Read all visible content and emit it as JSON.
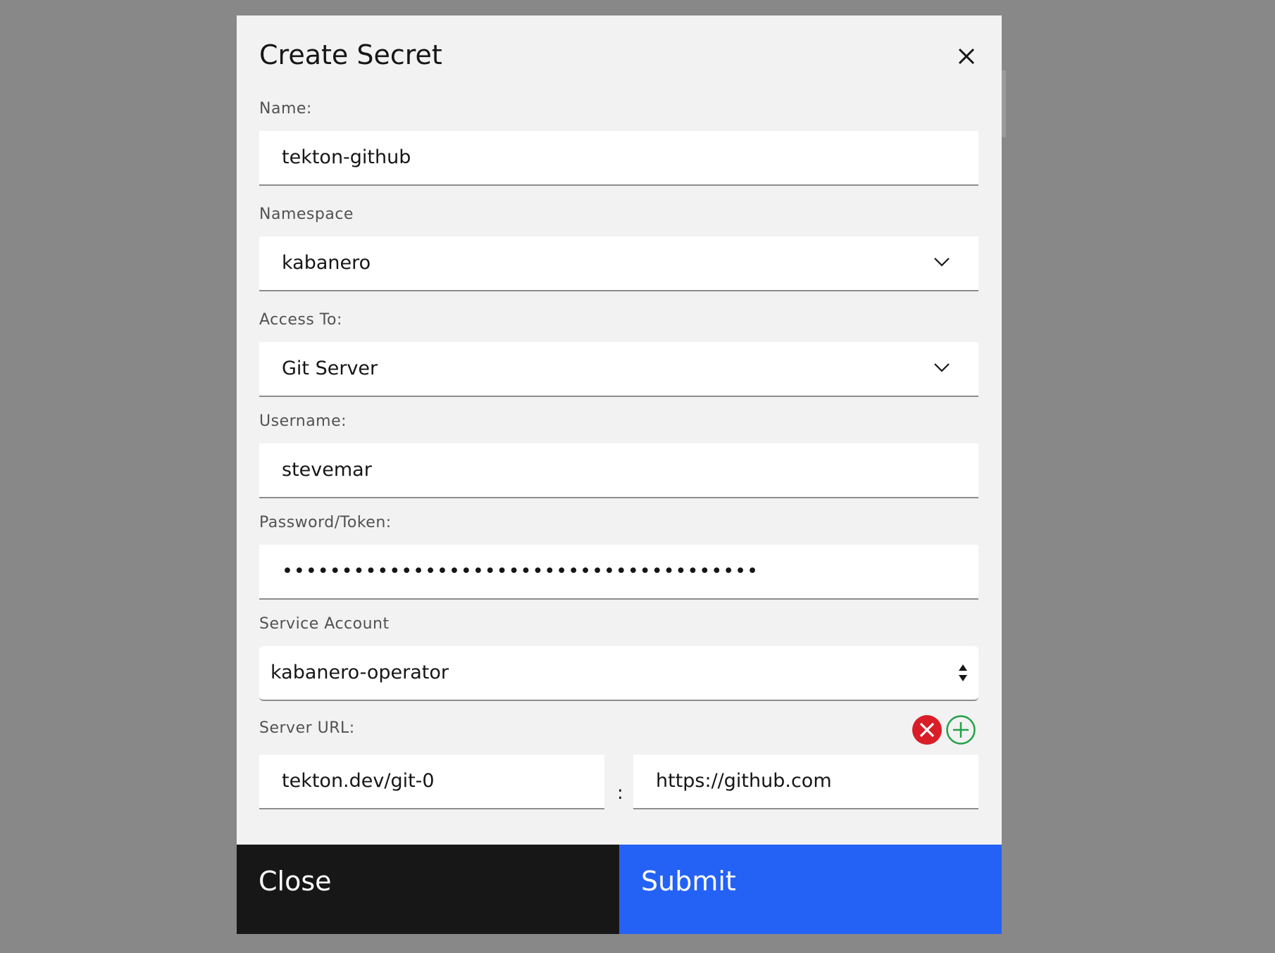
{
  "dialog": {
    "title": "Create Secret",
    "close_icon": "close-icon"
  },
  "fields": {
    "name": {
      "label": "Name:",
      "value": "tekton-github"
    },
    "namespace": {
      "label": "Namespace",
      "value": "kabanero",
      "icon": "chevron-down-icon"
    },
    "access_to": {
      "label": "Access To:",
      "value": "Git Server",
      "icon": "chevron-down-icon"
    },
    "username": {
      "label": "Username:",
      "value": "stevemar"
    },
    "password": {
      "label": "Password/Token:",
      "value": "••••••••••••••••••••••••••••••••••••••••"
    },
    "service_account": {
      "label": "Service Account",
      "value": "kabanero-operator",
      "icon": "up-down-arrows-icon"
    },
    "server_url": {
      "label": "Server URL:",
      "key": "tekton.dev/git-0",
      "separator": ":",
      "url": "https://github.com",
      "remove_icon": "remove-circle-icon",
      "add_icon": "add-circle-icon"
    }
  },
  "footer": {
    "close_label": "Close",
    "submit_label": "Submit"
  },
  "colors": {
    "overlay": "#888889",
    "modal_bg": "#f2f2f2",
    "submit": "#2462f6",
    "close": "#171717",
    "remove_icon": "#da1e28",
    "add_icon": "#24a148"
  }
}
